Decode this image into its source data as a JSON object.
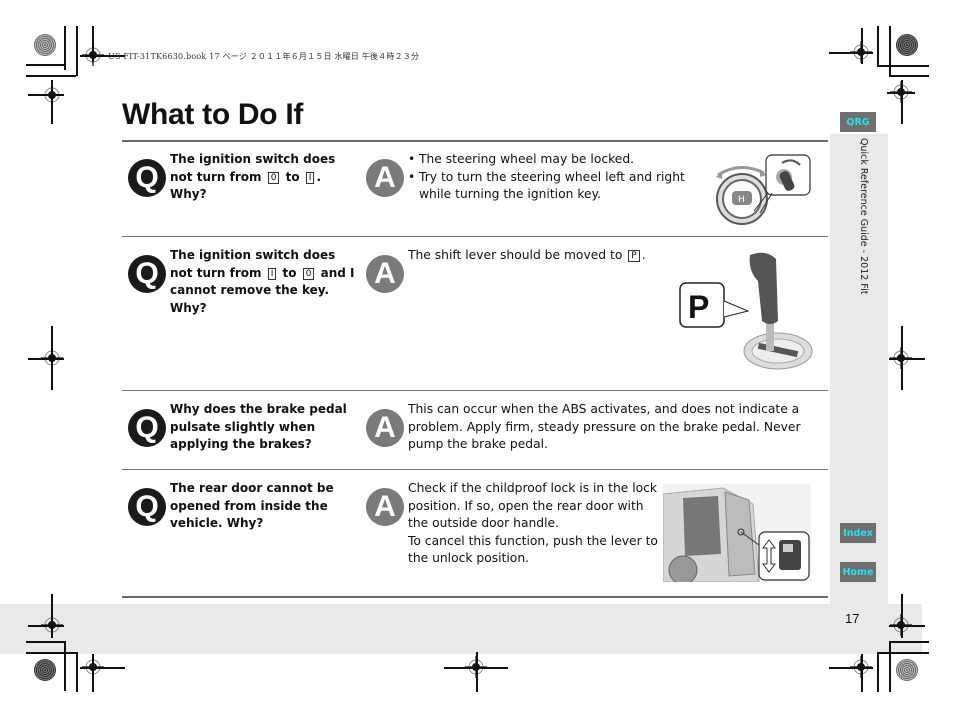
{
  "print_header": "US FIT-31TK6630.book  17 ページ  ２０１１年６月１５日  水曜日  午後４時２３分",
  "page": {
    "title": "What to Do If",
    "number": "17"
  },
  "sidebar": {
    "label": "Quick Reference Guide - 2012 Fit",
    "buttons": {
      "qrg": "QRG",
      "index": "Index",
      "home": "Home"
    }
  },
  "colors": {
    "nav_button_bg": "#6f6f6f",
    "nav_button_text": "#27e0f0",
    "q_badge": "#1a1a1a",
    "a_badge": "#7a7a7a",
    "band": "#e9e9e9"
  },
  "badges": {
    "q": "Q",
    "a": "A"
  },
  "qa": [
    {
      "question": {
        "pre": "The ignition switch does not turn from",
        "key1": "0",
        "mid": "to",
        "key2": "I",
        "post": ". Why?"
      },
      "answer_bullets": [
        "The steering wheel may be locked.",
        "Try to turn the steering wheel left and right while turning the ignition key."
      ],
      "illustration": "steering-wheel-and-ignition-key"
    },
    {
      "question": {
        "pre": "The ignition switch does not turn from",
        "key1": "I",
        "mid": "to",
        "key2": "0",
        "post": "and I cannot remove the key. Why?"
      },
      "answer": {
        "pre": "The shift lever should be moved to",
        "key": "P",
        "post": "."
      },
      "illustration": {
        "name": "shift-lever-in-park",
        "callout": "P"
      }
    },
    {
      "question": "Why does the brake pedal pulsate slightly when applying the brakes?",
      "answer": "This can occur when the ABS activates, and does not indicate a problem. Apply firm, steady pressure on the brake pedal. Never pump the brake pedal."
    },
    {
      "question": "The rear door cannot be opened from inside the vehicle. Why?",
      "answer_lines": [
        "Check if the childproof lock is in the lock position. If so, open the rear door with the outside door handle.",
        "To cancel this function, push the lever to the unlock position."
      ],
      "illustration": "rear-door-childproof-lock"
    }
  ]
}
